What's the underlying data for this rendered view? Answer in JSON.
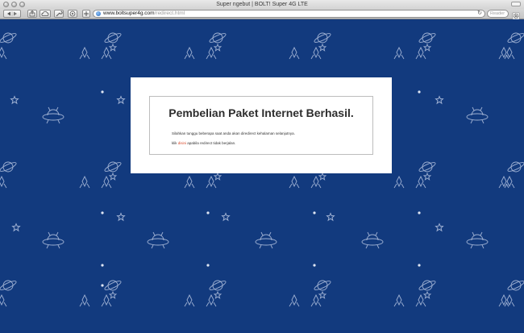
{
  "window": {
    "title": "Super ngebut | BOLT! Super 4G LTE"
  },
  "toolbar": {
    "url_domain": "www.boltsuper4g.com",
    "url_path": "/redirect.html",
    "reader_label": "Reader",
    "icons": [
      "back-icon",
      "forward-icon",
      "share-icon",
      "cloud-icon",
      "wrench-icon",
      "reading-list-icon",
      "add-tab-icon",
      "globe-icon",
      "reload-icon",
      "gear-icon"
    ]
  },
  "page": {
    "background_color": "#123a7e",
    "heading": "Pembelian Paket Internet Berhasil.",
    "message": "Silahkan tunggu beberapa saat anda akan diredirect kehalaman selanjutnya.",
    "klik": "klik",
    "link_text": "disini",
    "message_suffix": "apabila redirect tidak berjalan.",
    "link_color": "#d8492b"
  }
}
